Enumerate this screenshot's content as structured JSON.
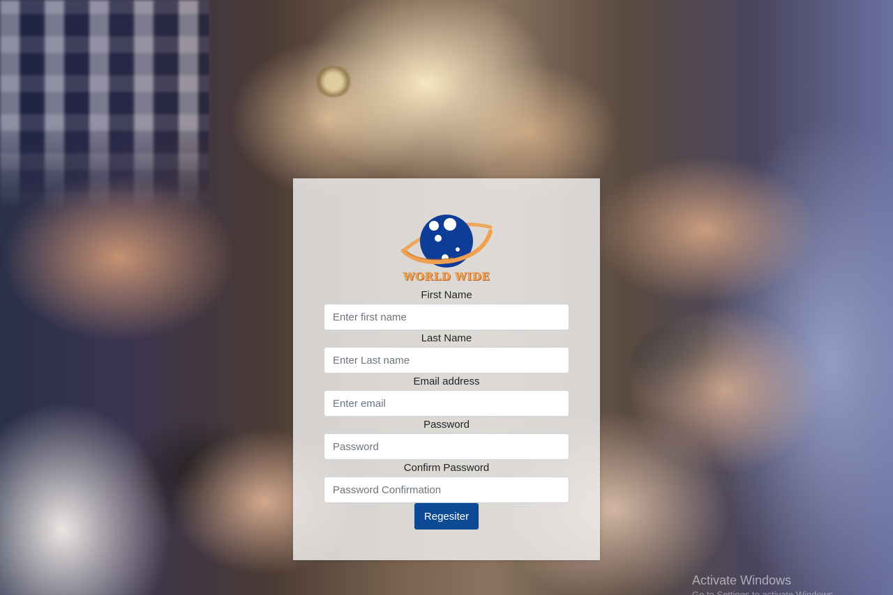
{
  "brand": {
    "name": "WORLD WIDE",
    "logo_icon": "planet-logo-icon",
    "colors": {
      "planet": "#0d3d96",
      "ring": "#f0a050",
      "text": "#f0a050"
    }
  },
  "form": {
    "fields": [
      {
        "label": "First Name",
        "placeholder": "Enter first name"
      },
      {
        "label": "Last Name",
        "placeholder": "Enter Last name"
      },
      {
        "label": "Email address",
        "placeholder": "Enter email"
      },
      {
        "label": "Password",
        "placeholder": "Password"
      },
      {
        "label": "Confirm Password",
        "placeholder": "Password Confirmation"
      }
    ],
    "submit_label": "Regesiter",
    "submit_color": "#0d4a96"
  },
  "watermark": {
    "title": "Activate Windows",
    "subtitle": "Go to Settings to activate Windows."
  }
}
